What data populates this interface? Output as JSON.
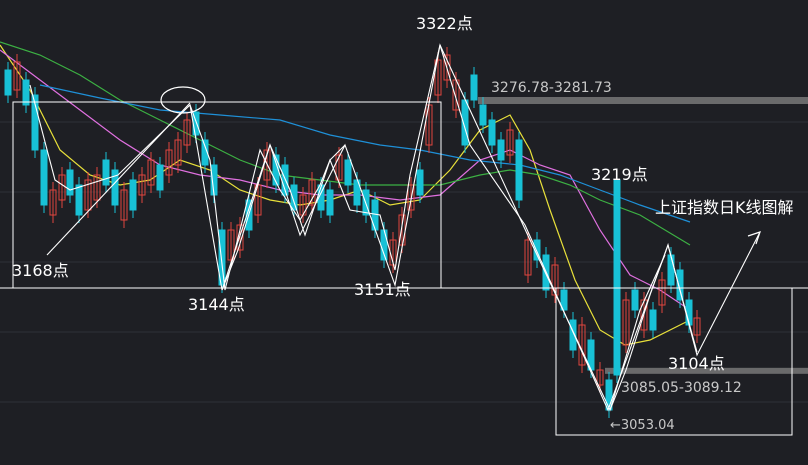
{
  "chart_data": {
    "type": "candlestick",
    "title": "上证指数日K线图解",
    "colors": {
      "background": "#1e1f24",
      "up_candle": "#e0463e",
      "down_candle": "#18c1d6",
      "ma_yellow": "#e8e03a",
      "ma_pink": "#e070e0",
      "ma_green": "#3cb043",
      "ma_blue": "#1e90d8",
      "wave_lines": "#ffffff",
      "boxes": "#ffffff",
      "band": "#8a8a8a"
    },
    "annotations": {
      "low_3168": "3168点",
      "low_3144": "3144点",
      "low_3151": "3151点",
      "high_3322": "3322点",
      "high_3219": "3219点",
      "low_3104": "3104点",
      "resistance_band": "3276.78-3281.73",
      "support_band": "3085.05-3089.12",
      "low_3053": "←3053.04"
    },
    "key_levels": [
      {
        "label": "3322",
        "value": 3322
      },
      {
        "label": "3276.78-3281.73",
        "value": 3279
      },
      {
        "label": "3219",
        "value": 3219
      },
      {
        "label": "3168",
        "value": 3168
      },
      {
        "label": "3151",
        "value": 3151
      },
      {
        "label": "3144",
        "value": 3144
      },
      {
        "label": "3104",
        "value": 3104
      },
      {
        "label": "3085.05-3089.12",
        "value": 3087
      },
      {
        "label": "3053.04",
        "value": 3053.04
      }
    ],
    "legend": "none",
    "grid": true
  }
}
